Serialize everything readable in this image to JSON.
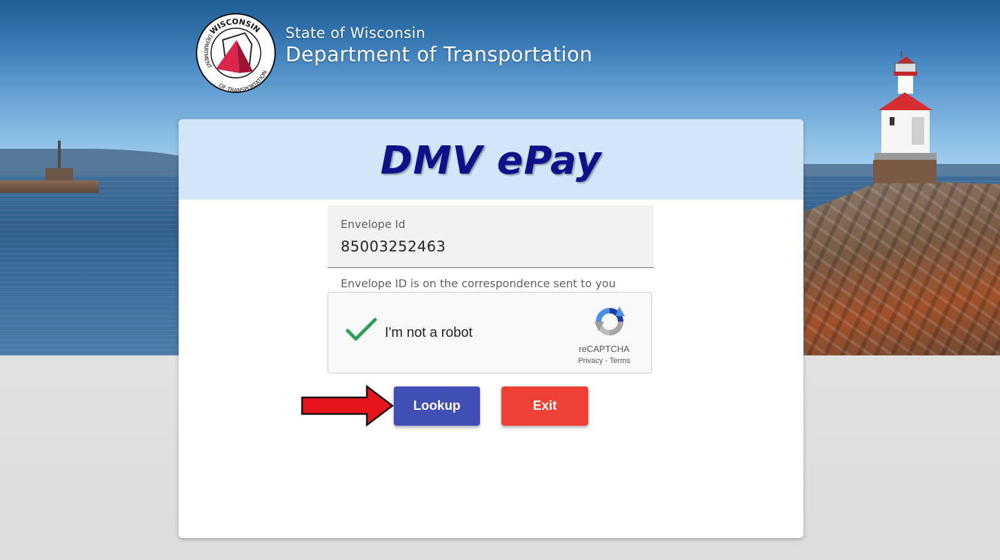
{
  "header": {
    "state_name": "State of Wisconsin",
    "department_name": "Department of Transportation",
    "seal": {
      "top_text": "WISCONSIN",
      "left_text": "DEPARTMENT",
      "bottom_text": "OF TRANSPORTATION"
    }
  },
  "app": {
    "title": "DMV ePay"
  },
  "form": {
    "envelope_field": {
      "label": "Envelope Id",
      "value": "85003252463",
      "hint": "Envelope ID is on the correspondence sent to you"
    },
    "recaptcha": {
      "label": "I'm not a robot",
      "checked": true,
      "brand": "reCAPTCHA",
      "privacy_link": "Privacy",
      "separator": " - ",
      "terms_link": "Terms"
    },
    "buttons": {
      "lookup": "Lookup",
      "exit": "Exit"
    }
  },
  "colors": {
    "title": "#0d128c",
    "card_header_bg": "#d3e6f8",
    "lookup_button": "#3f4fb5",
    "exit_button": "#ef4036",
    "check_mark": "#2e9e5e",
    "annotation_arrow": "#e8141b"
  },
  "icons": {
    "seal": "wisconsin-dot-seal-icon",
    "check": "check-icon",
    "recaptcha": "recaptcha-icon",
    "annotation": "red-arrow-icon"
  }
}
